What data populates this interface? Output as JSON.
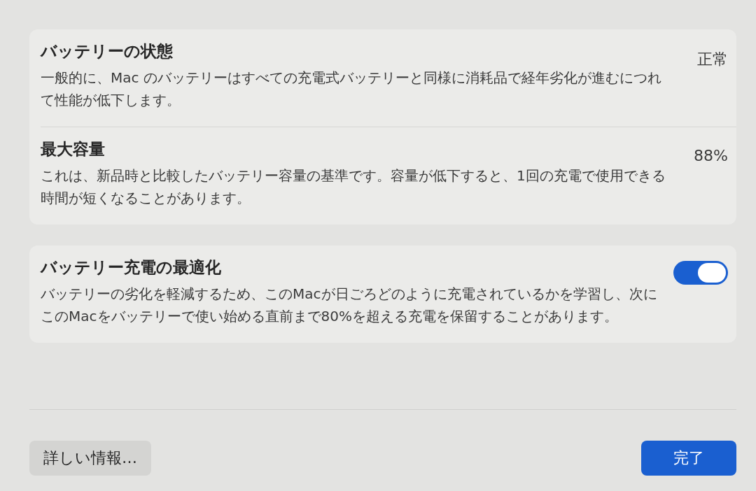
{
  "groups": [
    {
      "rows": [
        {
          "kind": "value",
          "title": "バッテリーの状態",
          "description": "一般的に、Mac のバッテリーはすべての充電式バッテリーと同様に消耗品で経年劣化が進むにつれて性能が低下します。",
          "value": "正常"
        },
        {
          "kind": "value",
          "title": "最大容量",
          "description": "これは、新品時と比較したバッテリー容量の基準です。容量が低下すると、1回の充電で使用できる時間が短くなることがあります。",
          "value": "88%"
        }
      ]
    },
    {
      "rows": [
        {
          "kind": "toggle",
          "title": "バッテリー充電の最適化",
          "description": "バッテリーの劣化を軽減するため、このMacが日ごろどのように充電されているかを学習し、次にこのMacをバッテリーで使い始める直前まで80%を超える充電を保留することがあります。",
          "on": true
        }
      ]
    }
  ],
  "buttons": [
    {
      "kind": "secondary",
      "label": "詳しい情報…"
    },
    {
      "kind": "primary",
      "label": "完了"
    }
  ]
}
